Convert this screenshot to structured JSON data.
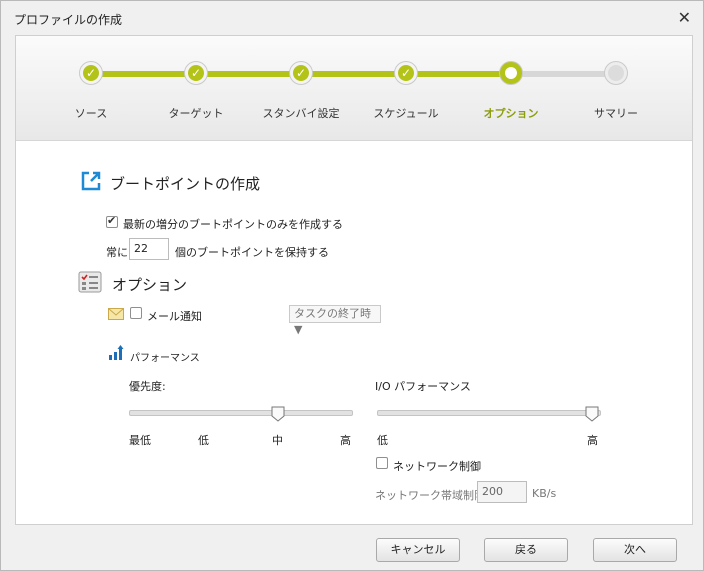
{
  "window": {
    "title": "プロファイルの作成",
    "close_glyph": "✕"
  },
  "wizard": {
    "steps": [
      {
        "label": "ソース",
        "state": "done"
      },
      {
        "label": "ターゲット",
        "state": "done"
      },
      {
        "label": "スタンバイ設定",
        "state": "done"
      },
      {
        "label": "スケジュール",
        "state": "done"
      },
      {
        "label": "オプション",
        "state": "current"
      },
      {
        "label": "サマリー",
        "state": "pending"
      }
    ],
    "check_glyph": "✓",
    "accent_color": "#b4c318"
  },
  "boot_point": {
    "title": "ブートポイントの作成",
    "icon": "external-link-icon",
    "only_latest_label": "最新の増分のブートポイントのみを作成する",
    "only_latest_checked": true,
    "keep_prefix": "常に",
    "keep_value": "22",
    "keep_suffix": "個のブートポイントを保持する"
  },
  "options": {
    "title": "オプション",
    "icon": "checklist-icon",
    "mail_icon": "envelope-icon",
    "mail_label": "メール通知",
    "mail_checked": false,
    "mail_dropdown": "タスクの終了時 ▼"
  },
  "performance": {
    "title": "パフォーマンス",
    "icon": "bar-chart-icon",
    "priority_label": "優先度:",
    "priority_ticks": [
      "最低",
      "低",
      "中",
      "高"
    ],
    "priority_level": "中",
    "io_label": "I/O パフォーマンス",
    "io_ticks": [
      "低",
      "高"
    ],
    "io_level": "高",
    "network_label": "ネットワーク制御",
    "network_checked": false,
    "bandwidth_label": "ネットワーク帯域制限:",
    "bandwidth_value": "200",
    "bandwidth_unit": "KB/s"
  },
  "buttons": {
    "cancel": "キャンセル",
    "back": "戻る",
    "next": "次へ"
  }
}
